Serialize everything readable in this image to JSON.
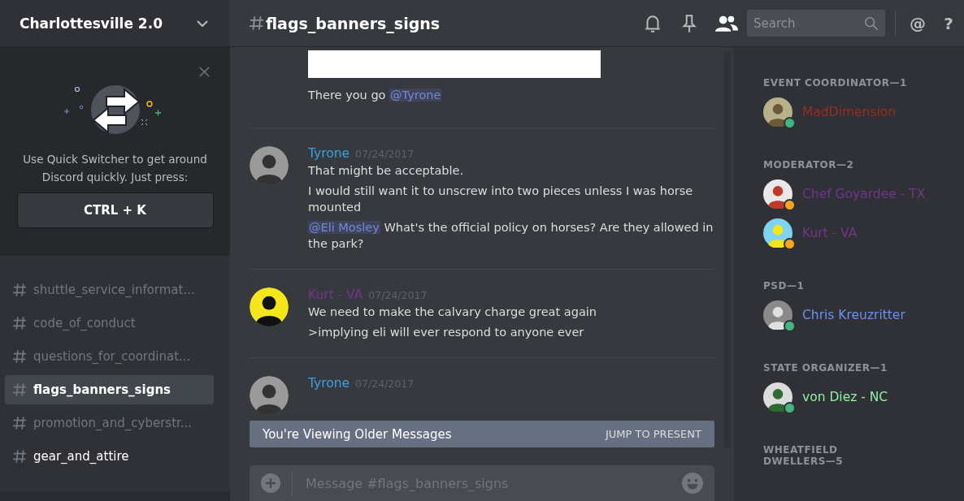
{
  "server": {
    "name": "Charlottesville 2.0"
  },
  "quick_switcher": {
    "text": "Use Quick Switcher to get around Discord quickly. Just press:",
    "shortcut": "CTRL + K"
  },
  "channels": [
    {
      "name": "shuttle_service_informat...",
      "selected": false,
      "unread": false
    },
    {
      "name": "code_of_conduct",
      "selected": false,
      "unread": false
    },
    {
      "name": "questions_for_coordinat...",
      "selected": false,
      "unread": false
    },
    {
      "name": "flags_banners_signs",
      "selected": true,
      "unread": true
    },
    {
      "name": "promotion_and_cyberstr...",
      "selected": false,
      "unread": false
    },
    {
      "name": "gear_and_attire",
      "selected": false,
      "unread": true
    }
  ],
  "channel_header": {
    "name": "flags_banners_signs"
  },
  "search": {
    "placeholder": "Search"
  },
  "header_buttons": [
    "@",
    "?"
  ],
  "messages": [
    {
      "kind": "tail",
      "attachment": true,
      "lines": [
        [
          {
            "text": "There you go "
          },
          {
            "mention": "@Tyrone"
          }
        ]
      ]
    },
    {
      "kind": "group",
      "author": "Tyrone",
      "color": "#3ea0e0",
      "time": "07/24/2017",
      "lines": [
        [
          {
            "text": "That might be acceptable."
          }
        ],
        [
          {
            "text": "I would still want it to unscrew into two pieces unless I was horse mounted"
          }
        ],
        [
          {
            "mention": "@Eli Mosley"
          },
          {
            "text": " What's the official policy on horses? Are they allowed in the park?"
          }
        ]
      ]
    },
    {
      "kind": "group",
      "author": "Kurt - VA",
      "color": "#71368a",
      "time": "07/24/2017",
      "lines": [
        [
          {
            "text": "We need to make the calvary charge great again"
          }
        ],
        [
          {
            "text": ">implying eli will ever respond to anyone ever"
          }
        ]
      ]
    },
    {
      "kind": "group",
      "author": "Tyrone",
      "color": "#3ea0e0",
      "time": "07/24/2017"
    }
  ],
  "older_banner": {
    "text": "You're Viewing Older Messages",
    "action": "JUMP TO PRESENT"
  },
  "composer": {
    "placeholder": "Message #flags_banners_signs"
  },
  "member_groups": [
    {
      "title": "EVENT COORDINATOR—1",
      "members": [
        {
          "name": "MadDimension",
          "color": "#992d22",
          "status": {
            "color": "#43b581"
          }
        }
      ]
    },
    {
      "title": "MODERATOR—2",
      "members": [
        {
          "name": "Chef Goyardee - TX",
          "color": "#71368a",
          "status": {
            "color": "#faa61a"
          }
        },
        {
          "name": "Kurt - VA",
          "color": "#71368a",
          "status": {
            "color": "#faa61a"
          }
        }
      ]
    },
    {
      "title": "PSD—1",
      "members": [
        {
          "name": "Chris Kreuzritter",
          "color": "#6e8ff0",
          "status": {
            "color": "#43b581"
          }
        }
      ]
    },
    {
      "title": "STATE ORGANIZER—1",
      "members": [
        {
          "name": "von Diez - NC",
          "color": "#8ef1a2",
          "status": {
            "color": "#43b581"
          }
        }
      ]
    },
    {
      "title": "WHEATFIELD DWELLERS—5"
    }
  ]
}
